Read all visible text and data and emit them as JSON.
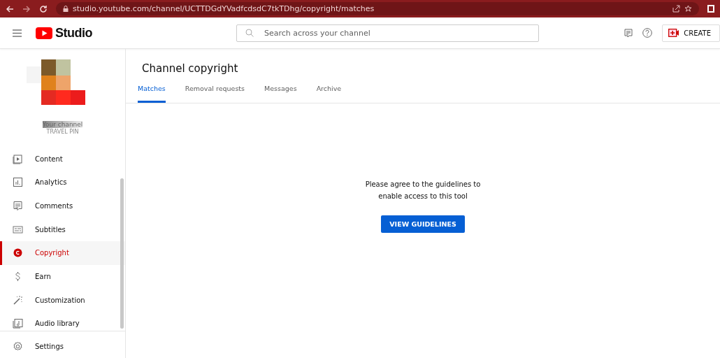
{
  "browser": {
    "url": "studio.youtube.com/channel/UCTTDGdYVadfcdsdC7tkTDhg/copyright/matches"
  },
  "header": {
    "logo": "Studio",
    "search": {
      "placeholder": "Search across your channel"
    },
    "create_button": "CREATE"
  },
  "sidebar": {
    "channel": {
      "name": "Your channel",
      "handle": "TRAVEL PIN"
    },
    "items": [
      {
        "label": "Content",
        "selected": false
      },
      {
        "label": "Analytics",
        "selected": false
      },
      {
        "label": "Comments",
        "selected": false
      },
      {
        "label": "Subtitles",
        "selected": false
      },
      {
        "label": "Copyright",
        "selected": true
      },
      {
        "label": "Earn",
        "selected": false
      },
      {
        "label": "Customization",
        "selected": false
      },
      {
        "label": "Audio library",
        "selected": false
      }
    ],
    "footer_items": [
      {
        "label": "Settings",
        "selected": false
      }
    ]
  },
  "page": {
    "title": "Channel copyright",
    "tabs": [
      {
        "label": "Matches",
        "selected": true
      },
      {
        "label": "Removal requests",
        "selected": false
      },
      {
        "label": "Messages",
        "selected": false
      },
      {
        "label": "Archive",
        "selected": false
      }
    ],
    "message": "Please agree to the guidelines to enable access to this tool",
    "button": "VIEW GUIDELINES"
  }
}
